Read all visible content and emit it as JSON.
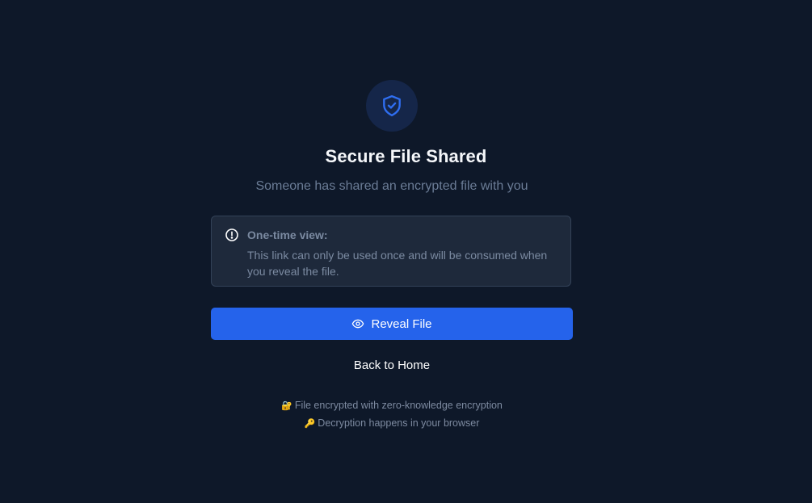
{
  "header": {
    "icon": "shield-check-icon",
    "title": "Secure File Shared",
    "subtitle": "Someone has shared an encrypted file with you"
  },
  "notice": {
    "icon": "info-circle-icon",
    "title": "One-time view:",
    "text": "This link can only be used once and will be consumed when you reveal the file."
  },
  "actions": {
    "reveal_label": "Reveal File",
    "reveal_icon": "eye-icon",
    "back_label": "Back to Home"
  },
  "footer": {
    "line1_icon": "🔐",
    "line1_text": "File encrypted with zero-knowledge encryption",
    "line2_icon": "🔑",
    "line2_text": "Decryption happens in your browser"
  },
  "colors": {
    "background": "#0e1829",
    "accent": "#2563eb",
    "notice_bg": "#1e293b"
  }
}
